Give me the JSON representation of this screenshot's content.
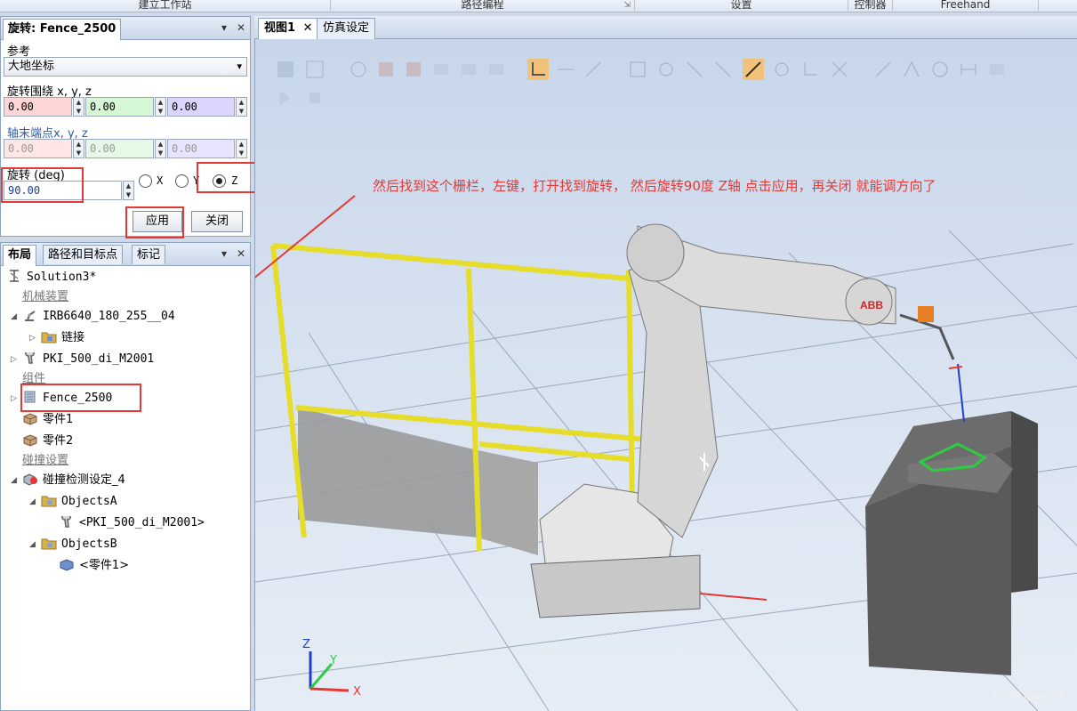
{
  "ribbon": {
    "groups": [
      "建立工作站",
      "路径编程",
      "设置",
      "控制器",
      "Freehand"
    ]
  },
  "rotate_panel": {
    "title": "旋转: Fence_2500",
    "reference_label": "参考",
    "reference_value": "大地坐标",
    "around_label": "旋转围绕 x, y, z",
    "around": [
      "0.00",
      "0.00",
      "0.00"
    ],
    "axis_end_label": "轴末端点x, y, z",
    "axis_end": [
      "0.00",
      "0.00",
      "0.00"
    ],
    "angle_label": "旋转 (deg)",
    "angle_value": "90.00",
    "axis_options": [
      "X",
      "Y",
      "Z"
    ],
    "axis_selected": "Z",
    "apply_label": "应用",
    "close_label": "关闭"
  },
  "layout_panel": {
    "tabs": [
      "布局",
      "路径和目标点",
      "标记"
    ],
    "tree": {
      "solution": "Solution3*",
      "mech_header": "机械装置",
      "robot": "IRB6640_180_255__04",
      "robot_child": "链接",
      "tool": "PKI_500_di_M2001",
      "comp_header": "组件",
      "fence": "Fence_2500",
      "part1": "零件1",
      "part2": "零件2",
      "collision_header": "碰撞设置",
      "collision_set": "碰撞检测设定_4",
      "objects_a": "ObjectsA",
      "objects_a_child": "<PKI_500_di_M2001>",
      "objects_b": "ObjectsB",
      "objects_b_child": "<零件1>"
    }
  },
  "view": {
    "tabs": [
      "视图1",
      "仿真设定"
    ],
    "annotation": "然后找到这个栅栏，左键，打开找到旋转， 然后旋转90度 Z轴 点击应用，再关闭 就能调方向了",
    "robot_logo": "ABB",
    "axis_labels": [
      "Z",
      "Y",
      "X"
    ],
    "watermark": "CSDN @lwj_07"
  },
  "colors": {
    "annotation": "#e53935",
    "fence": "#f0e63a",
    "field_x": "#ffd6d6",
    "field_y": "#d6f7d6",
    "field_z": "#dcd6ff"
  }
}
